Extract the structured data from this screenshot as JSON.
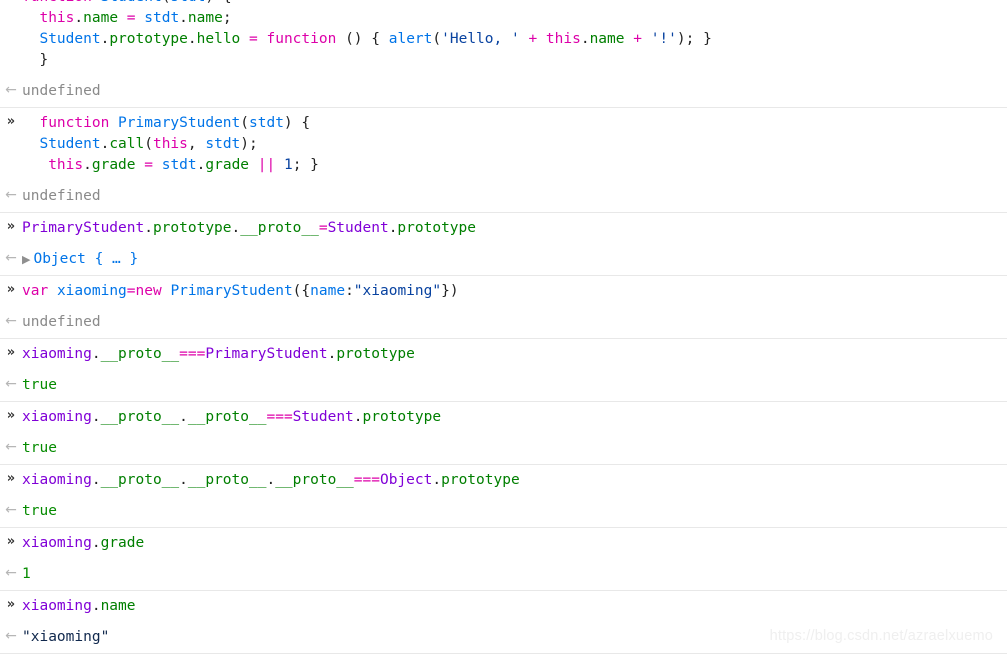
{
  "console": {
    "input_marker": "»",
    "output_marker": "←",
    "entries": [
      {
        "input_lines": [
          "function Student(stdt) {",
          "  this.name = stdt.name;",
          "  Student.prototype.hello = function () { alert('Hello, ' + this.name + '!'); }",
          "  }"
        ],
        "output": "undefined",
        "output_kind": "undefined"
      },
      {
        "input_lines": [
          "  function PrimaryStudent(stdt) {",
          "  Student.call(this, stdt);",
          "   this.grade = stdt.grade || 1; }"
        ],
        "output": "undefined",
        "output_kind": "undefined"
      },
      {
        "input_lines": [
          "PrimaryStudent.prototype.__proto__=Student.prototype"
        ],
        "output": "Object { … }",
        "output_kind": "object",
        "expander": "▶"
      },
      {
        "input_lines": [
          "var xiaoming=new PrimaryStudent({name:\"xiaoming\"})"
        ],
        "output": "undefined",
        "output_kind": "undefined"
      },
      {
        "input_lines": [
          "xiaoming.__proto__===PrimaryStudent.prototype"
        ],
        "output": "true",
        "output_kind": "boolean"
      },
      {
        "input_lines": [
          "xiaoming.__proto__.__proto__===Student.prototype"
        ],
        "output": "true",
        "output_kind": "boolean"
      },
      {
        "input_lines": [
          "xiaoming.__proto__.__proto__.__proto__===Object.prototype"
        ],
        "output": "true",
        "output_kind": "boolean"
      },
      {
        "input_lines": [
          "xiaoming.grade"
        ],
        "output": "1",
        "output_kind": "number"
      },
      {
        "input_lines": [
          "xiaoming.name"
        ],
        "output": "\"xiaoming\"",
        "output_kind": "string"
      }
    ]
  },
  "watermark": {
    "text": "https://blog.csdn.net/azraelxuemo"
  },
  "colors": {
    "keyword": "#dd00a9",
    "function_name": "#0074e8",
    "property": "#007f00",
    "identifier": "#8000d7",
    "string": "#0842a0",
    "boolean_output": "#058b00",
    "undefined_output": "#8a8a8a",
    "object_output": "#0074e8",
    "string_output": "#10284d",
    "separator": "#e8e8e8",
    "background": "#ffffff"
  }
}
